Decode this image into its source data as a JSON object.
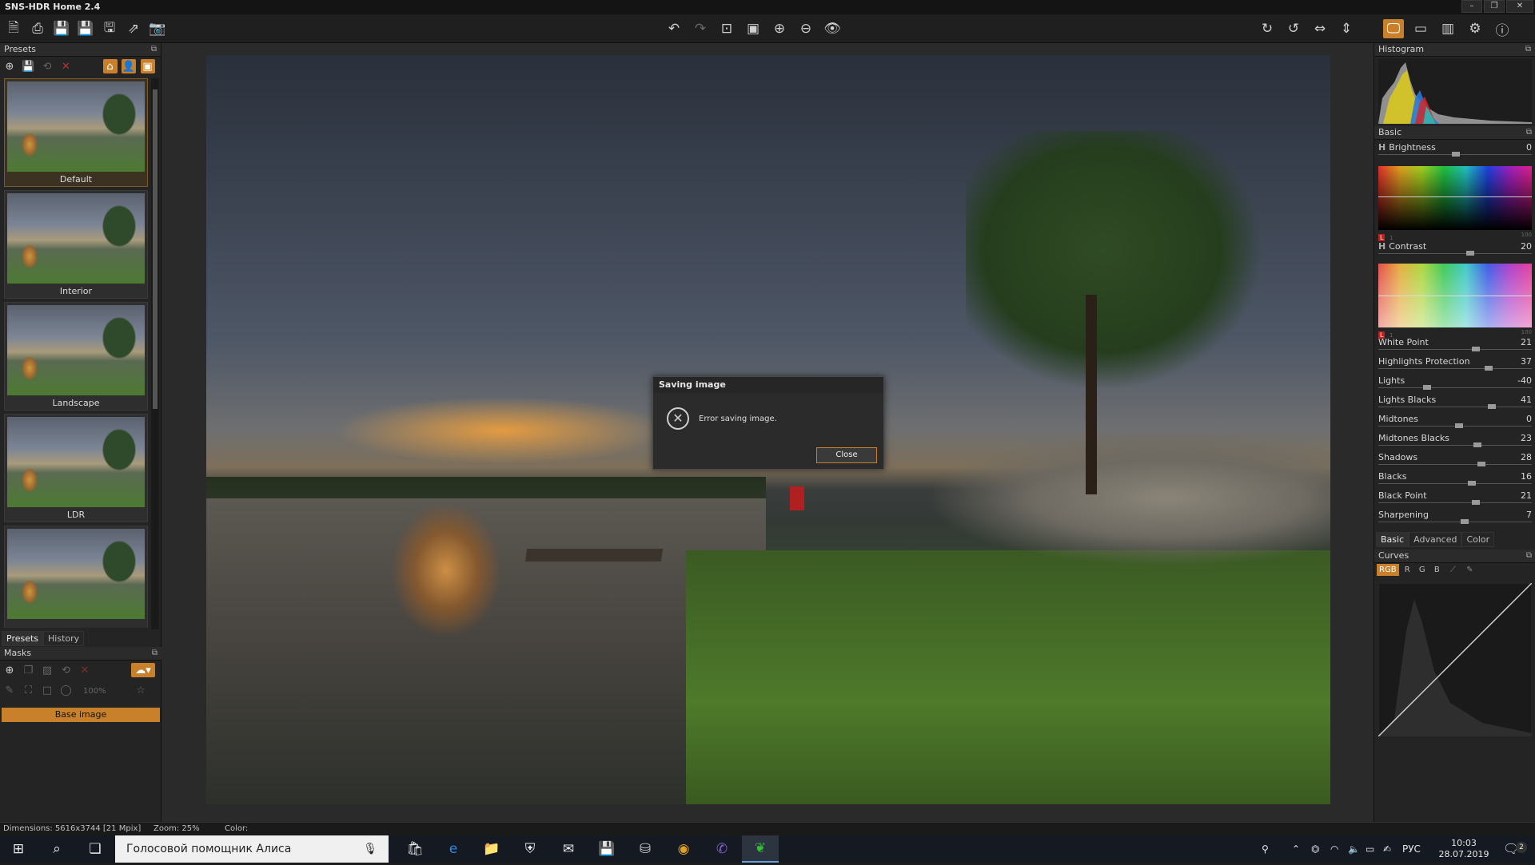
{
  "window": {
    "title": "SNS-HDR Home 2.4",
    "controls": [
      "–",
      "❐",
      "✕"
    ]
  },
  "toolbar": {
    "left": [
      {
        "name": "open-icon",
        "glyph": "🗎"
      },
      {
        "name": "batch-icon",
        "glyph": "⎙"
      },
      {
        "name": "sns-save-icon",
        "glyph": "💾"
      },
      {
        "name": "save-icon",
        "glyph": "💾"
      },
      {
        "name": "save-as-icon",
        "glyph": "🖫"
      },
      {
        "name": "export-icon",
        "glyph": "⇗"
      },
      {
        "name": "snapshot-icon",
        "glyph": "📷"
      }
    ],
    "center": [
      {
        "name": "undo-icon",
        "glyph": "↶",
        "dim": false
      },
      {
        "name": "redo-icon",
        "glyph": "↷",
        "dim": true
      },
      {
        "name": "zoom-1to1-icon",
        "glyph": "⊡",
        "dim": false
      },
      {
        "name": "fit-icon",
        "glyph": "▣",
        "dim": false
      },
      {
        "name": "zoom-in-icon",
        "glyph": "⊕",
        "dim": false
      },
      {
        "name": "zoom-out-icon",
        "glyph": "⊖",
        "dim": false
      },
      {
        "name": "preview-eye-icon",
        "glyph": "👁",
        "dim": false
      }
    ],
    "right": [
      {
        "name": "rotate-cw-icon",
        "glyph": "↻"
      },
      {
        "name": "rotate-ccw-icon",
        "glyph": "↺"
      },
      {
        "name": "flip-h-icon",
        "glyph": "⇔"
      },
      {
        "name": "flip-v-icon",
        "glyph": "⇕"
      }
    ],
    "far_right": [
      {
        "name": "monitor-icon",
        "glyph": "🖵",
        "on": true
      },
      {
        "name": "layout-single-icon",
        "glyph": "▭",
        "on": false
      },
      {
        "name": "layout-split-icon",
        "glyph": "▥",
        "on": false
      },
      {
        "name": "settings-gear-icon",
        "glyph": "⚙",
        "on": false
      },
      {
        "name": "info-icon",
        "glyph": "ⓘ",
        "on": false
      }
    ]
  },
  "presets": {
    "title": "Presets",
    "items": [
      "Default",
      "Interior",
      "Landscape",
      "LDR",
      ""
    ],
    "tabs": [
      "Presets",
      "History"
    ]
  },
  "masks": {
    "title": "Masks",
    "zoom": "100%",
    "base_label": "Base image"
  },
  "dialog": {
    "title": "Saving image",
    "message": "Error saving image.",
    "close_label": "Close"
  },
  "right_panel": {
    "histogram_title": "Histogram",
    "basic_title": "Basic",
    "brightness": {
      "label": "Brightness",
      "value": "0",
      "h": "H",
      "l": "L",
      "min": "1",
      "max": "100"
    },
    "contrast": {
      "label": "Contrast",
      "value": "20",
      "h": "H",
      "l": "L",
      "min": "1",
      "max": "100"
    },
    "sliders": [
      {
        "label": "White Point",
        "value": "21"
      },
      {
        "label": "Highlights Protection",
        "value": "37"
      },
      {
        "label": "Lights",
        "value": "-40"
      },
      {
        "label": "Lights Blacks",
        "value": "41"
      },
      {
        "label": "Midtones",
        "value": "0"
      },
      {
        "label": "Midtones Blacks",
        "value": "23"
      },
      {
        "label": "Shadows",
        "value": "28"
      },
      {
        "label": "Blacks",
        "value": "16"
      },
      {
        "label": "Black Point",
        "value": "21"
      },
      {
        "label": "Sharpening",
        "value": "7"
      }
    ],
    "tabs": [
      "Basic",
      "Advanced",
      "Color"
    ],
    "curves_title": "Curves",
    "curve_channels": [
      "RGB",
      "R",
      "G",
      "B"
    ]
  },
  "status": {
    "dimensions": "Dimensions: 5616x3744 [21 Mpix]",
    "zoom": "Zoom: 25%",
    "color": "Color:"
  },
  "taskbar": {
    "search_text": "Голосовой помощник Алиса",
    "lang": "РУС",
    "time": "10:03",
    "date": "28.07.2019",
    "notif_count": "2"
  }
}
